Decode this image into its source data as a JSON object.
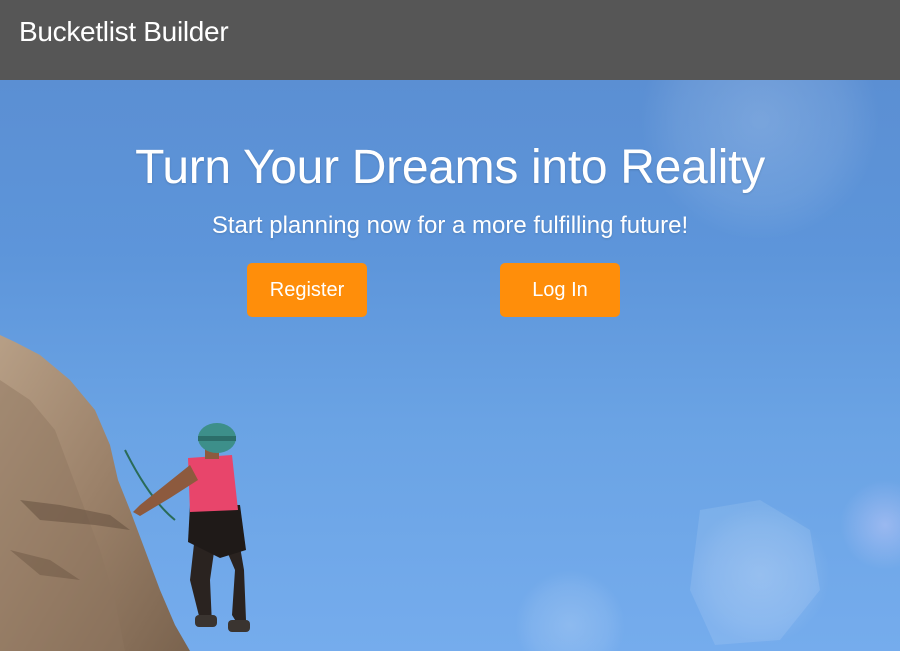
{
  "navbar": {
    "brand": "Bucketlist Builder",
    "background": "#565656"
  },
  "hero": {
    "title": "Turn Your Dreams into Reality",
    "subtitle": "Start planning now for a more fulfilling future!",
    "image": "rock-climber-against-blue-sky",
    "sky_color": "#5d95da"
  },
  "actions": {
    "register_label": "Register",
    "login_label": "Log In",
    "button_color": "#ff8e0a"
  }
}
